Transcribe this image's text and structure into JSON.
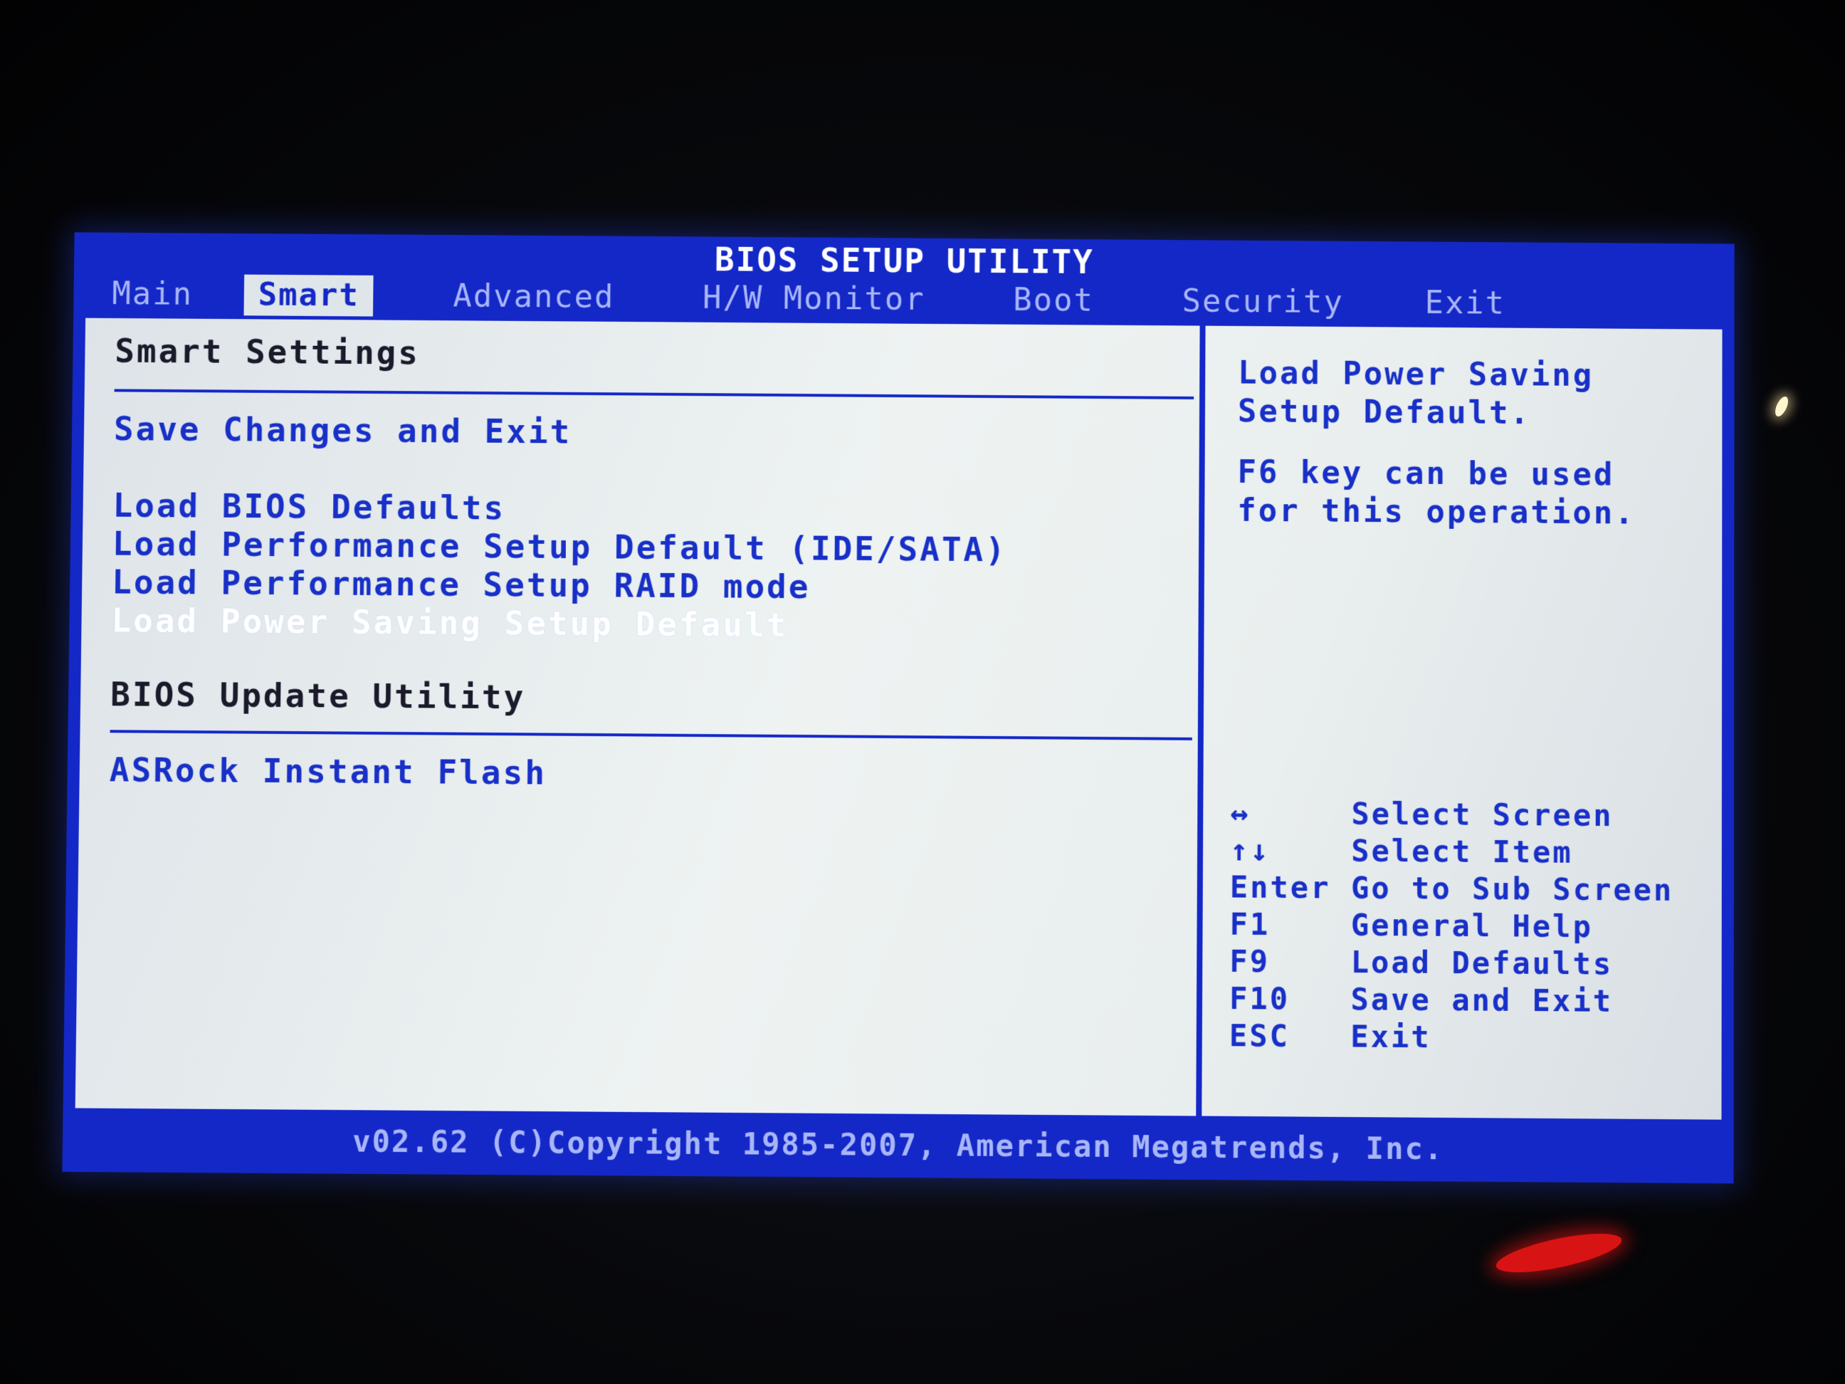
{
  "header": {
    "title": "BIOS SETUP UTILITY"
  },
  "menu": {
    "tabs": [
      {
        "label": "Main",
        "active": false
      },
      {
        "label": "Smart",
        "active": true
      },
      {
        "label": "Advanced",
        "active": false
      },
      {
        "label": "H/W Monitor",
        "active": false
      },
      {
        "label": "Boot",
        "active": false
      },
      {
        "label": "Security",
        "active": false
      },
      {
        "label": "Exit",
        "active": false
      }
    ]
  },
  "main": {
    "section_title": "Smart Settings",
    "save_exit": "Save Changes and Exit",
    "load_bios_defaults": "Load BIOS Defaults",
    "load_perf_ide": "Load Performance Setup Default (IDE/SATA)",
    "load_perf_raid": "Load Performance Setup RAID mode",
    "load_power_saving": "Load Power Saving Setup Default",
    "bios_update_title": "BIOS Update Utility",
    "instant_flash": "ASRock Instant Flash"
  },
  "help": {
    "description": "Load Power Saving\nSetup Default.",
    "hint": "F6 key can be used\nfor this operation.",
    "keys": [
      {
        "key": "↔",
        "action": "Select Screen"
      },
      {
        "key": "↑↓",
        "action": "Select Item"
      },
      {
        "key": "Enter",
        "action": "Go to Sub Screen"
      },
      {
        "key": "F1",
        "action": "General Help"
      },
      {
        "key": "F9",
        "action": "Load Defaults"
      },
      {
        "key": "F10",
        "action": "Save and Exit"
      },
      {
        "key": "ESC",
        "action": "Exit"
      }
    ]
  },
  "footer": {
    "copyright": "v02.62 (C)Copyright 1985-2007, American Megatrends, Inc."
  },
  "colors": {
    "bios_blue": "#1428c8",
    "panel_bg": "#e6ecee",
    "selected_text": "#ffffff"
  }
}
